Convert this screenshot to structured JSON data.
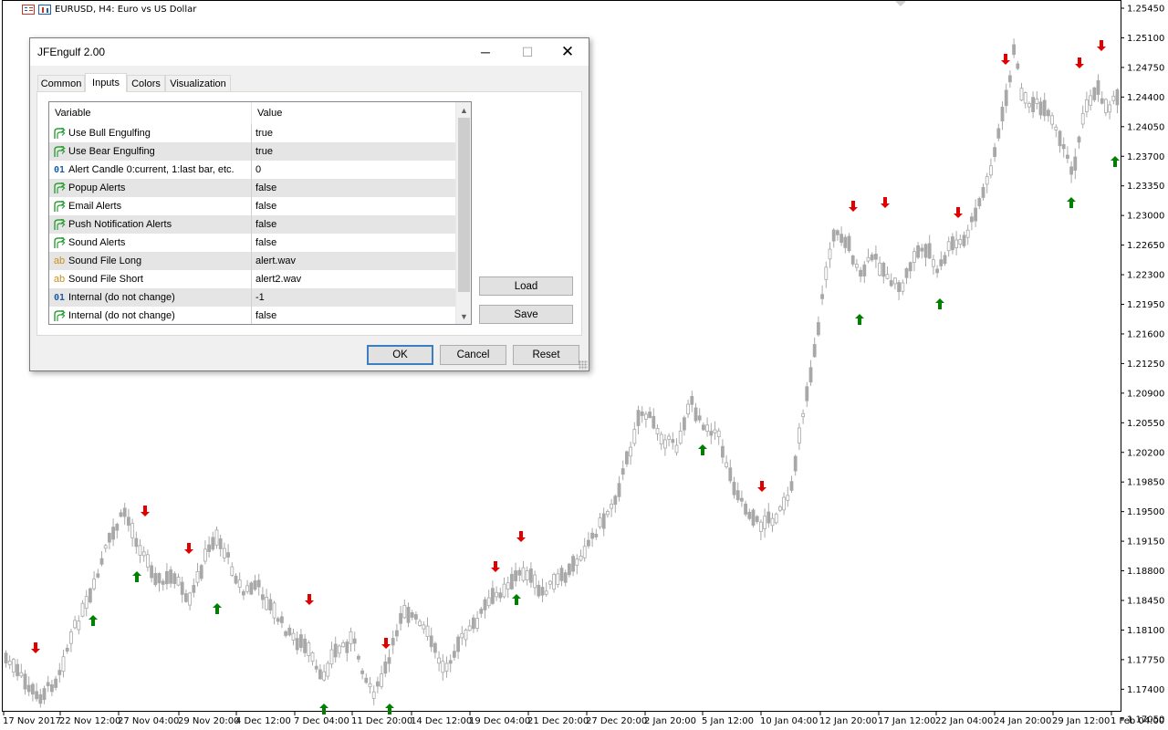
{
  "chart": {
    "symbol_title": "EURUSD, H4:  Euro vs US Dollar",
    "price_labels": [
      "1.25450",
      "1.25100",
      "1.24750",
      "1.24400",
      "1.24050",
      "1.23700",
      "1.23350",
      "1.23000",
      "1.22650",
      "1.22300",
      "1.21950",
      "1.21600",
      "1.21250",
      "1.20900",
      "1.20550",
      "1.20200",
      "1.19850",
      "1.19500",
      "1.19150",
      "1.18800",
      "1.18450",
      "1.18100",
      "1.17750",
      "1.17400",
      "1.17050"
    ],
    "time_labels": [
      "17 Nov 2017",
      "22 Nov 12:00",
      "27 Nov 04:00",
      "29 Nov 20:00",
      "4 Dec 12:00",
      "7 Dec 04:00",
      "11 Dec 20:00",
      "14 Dec 12:00",
      "19 Dec 04:00",
      "21 Dec 20:00",
      "27 Dec 20:00",
      "2 Jan 20:00",
      "5 Jan 12:00",
      "10 Jan 04:00",
      "12 Jan 20:00",
      "17 Jan 12:00",
      "22 Jan 04:00",
      "24 Jan 20:00",
      "29 Jan 12:00",
      "1 Feb 04:00"
    ],
    "colors": {
      "candle": "#a8a8a8",
      "bull_arrow": "#008000",
      "bear_arrow": "#e00000",
      "axis": "#000000"
    }
  },
  "dialog": {
    "title": "JFEngulf 2.00",
    "window_controls": {
      "minimize": "─",
      "maximize": "☐",
      "close": "✕"
    },
    "tabs": [
      "Common",
      "Inputs",
      "Colors",
      "Visualization"
    ],
    "active_tab": "Inputs",
    "grid": {
      "columns": [
        "Variable",
        "Value"
      ],
      "rows": [
        {
          "icon": "bool-icon",
          "variable": "Use Bull Engulfing",
          "value": "true"
        },
        {
          "icon": "bool-icon",
          "variable": "Use Bear Engulfing",
          "value": "true"
        },
        {
          "icon": "number-icon",
          "variable": "Alert Candle 0:current, 1:last bar, etc.",
          "value": "0"
        },
        {
          "icon": "bool-icon",
          "variable": "Popup Alerts",
          "value": "false"
        },
        {
          "icon": "bool-icon",
          "variable": "Email Alerts",
          "value": "false"
        },
        {
          "icon": "bool-icon",
          "variable": "Push Notification Alerts",
          "value": "false"
        },
        {
          "icon": "bool-icon",
          "variable": "Sound Alerts",
          "value": "false"
        },
        {
          "icon": "string-icon",
          "variable": "Sound File Long",
          "value": "alert.wav"
        },
        {
          "icon": "string-icon",
          "variable": "Sound File Short",
          "value": "alert2.wav"
        },
        {
          "icon": "number-icon",
          "variable": "Internal (do not change)",
          "value": "-1"
        },
        {
          "icon": "bool-icon",
          "variable": "Internal (do not change)",
          "value": "false"
        }
      ]
    },
    "icon_glyphs": {
      "number": "01",
      "string": "ab"
    },
    "side_buttons": {
      "load": "Load",
      "save": "Save"
    },
    "footer_buttons": {
      "ok": "OK",
      "cancel": "Cancel",
      "reset": "Reset"
    }
  }
}
